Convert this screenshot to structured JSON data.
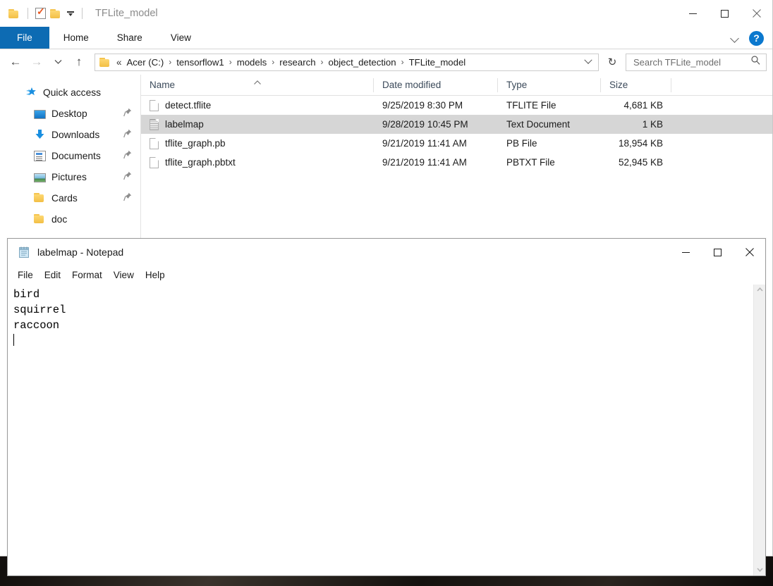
{
  "explorer": {
    "title": "TFLite_model",
    "quick_access_toolbar": [
      {
        "name": "folder-icon",
        "label": ""
      },
      {
        "name": "properties-icon",
        "label": ""
      },
      {
        "name": "new-folder-icon",
        "label": ""
      },
      {
        "name": "customize-dropdown-icon",
        "label": ""
      }
    ],
    "window_controls": {
      "minimize": "—",
      "maximize": "□",
      "close": "✕"
    },
    "ribbon": {
      "tabs": [
        {
          "label": "File",
          "active": true
        },
        {
          "label": "Home",
          "active": false
        },
        {
          "label": "Share",
          "active": false
        },
        {
          "label": "View",
          "active": false
        }
      ],
      "expand_label": "",
      "help_label": "?"
    },
    "navigation": {
      "back": "←",
      "forward": "→",
      "recent": "⌄",
      "up": "↑",
      "refresh": "↻",
      "breadcrumb_lead": "«",
      "breadcrumb": [
        "Acer (C:)",
        "tensorflow1",
        "models",
        "research",
        "object_detection",
        "TFLite_model"
      ],
      "breadcrumb_separator": "›"
    },
    "search": {
      "placeholder": "Search TFLite_model",
      "value": "",
      "icon": "search-icon"
    },
    "nav_pane": {
      "root": {
        "label": "Quick access",
        "icon": "quick-access-star-icon"
      },
      "items": [
        {
          "label": "Desktop",
          "icon": "desktop-icon",
          "pinned": true
        },
        {
          "label": "Downloads",
          "icon": "downloads-arrow-icon",
          "pinned": true
        },
        {
          "label": "Documents",
          "icon": "documents-icon",
          "pinned": true
        },
        {
          "label": "Pictures",
          "icon": "pictures-icon",
          "pinned": true
        },
        {
          "label": "Cards",
          "icon": "folder-icon",
          "pinned": true
        },
        {
          "label": "doc",
          "icon": "folder-icon",
          "pinned": false
        }
      ],
      "pin_glyph": "📌"
    },
    "file_list": {
      "columns": [
        "Name",
        "Date modified",
        "Type",
        "Size"
      ],
      "sort_column": "Name",
      "sort_direction": "ascending",
      "rows": [
        {
          "name": "detect.tflite",
          "date": "9/25/2019 8:30 PM",
          "type": "TFLITE File",
          "size": "4,681 KB",
          "selected": false,
          "icon": "generic-file-icon"
        },
        {
          "name": "labelmap",
          "date": "9/28/2019 10:45 PM",
          "type": "Text Document",
          "size": "1 KB",
          "selected": true,
          "icon": "text-file-icon"
        },
        {
          "name": "tflite_graph.pb",
          "date": "9/21/2019 11:41 AM",
          "type": "PB File",
          "size": "18,954 KB",
          "selected": false,
          "icon": "generic-file-icon"
        },
        {
          "name": "tflite_graph.pbtxt",
          "date": "9/21/2019 11:41 AM",
          "type": "PBTXT File",
          "size": "52,945 KB",
          "selected": false,
          "icon": "generic-file-icon"
        }
      ]
    }
  },
  "notepad": {
    "title": "labelmap - Notepad",
    "icon": "notepad-icon",
    "window_controls": {
      "minimize": "—",
      "maximize": "□",
      "close": "✕"
    },
    "menu": [
      "File",
      "Edit",
      "Format",
      "View",
      "Help"
    ],
    "document": {
      "lines": [
        "bird",
        "squirrel",
        "raccoon",
        ""
      ],
      "text": "bird\nsquirrel\nraccoon\n"
    },
    "scrollbar": {
      "up_arrow": "⌃",
      "down_arrow": "⌄"
    }
  },
  "colors": {
    "ribbon_file_tab": "#0d6bb3",
    "help_button": "#0b78ce",
    "selection_row": "#d6d6d6",
    "column_header_text": "#3b4a5a",
    "folder_yellow": "#f3bf45"
  }
}
